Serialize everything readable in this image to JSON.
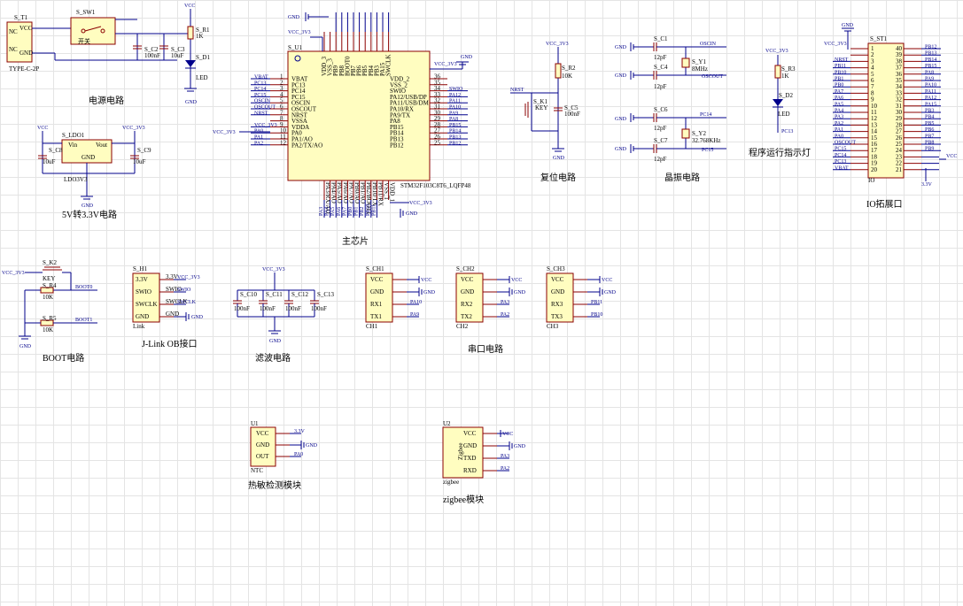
{
  "captions": {
    "power": "电源电路",
    "ldo": "5V转3.3V电路",
    "mcu": "主芯片",
    "reset": "复位电路",
    "crystal": "晶振电路",
    "led": "程序运行指示灯",
    "io": "IO拓展口",
    "boot": "BOOT电路",
    "jlink": "J-Link OB接口",
    "filter": "滤波电路",
    "serial": "串口电路",
    "thermal": "热敏检测模块",
    "zigbee": "zigbee模块"
  },
  "nets": {
    "vcc": "VCC",
    "vcc3v3": "VCC_3V3",
    "gnd": "GND",
    "v33": "3.3V"
  },
  "power": {
    "t1_ref": "S_T1",
    "t1_part": "TYPE-C-2P",
    "t1_pins": [
      "NC",
      "VCC",
      "NC",
      "GND"
    ],
    "sw1_ref": "S_SW1",
    "sw1_name": "开关",
    "c2_ref": "S_C2",
    "c2_val": "100nF",
    "c3_ref": "S_C3",
    "c3_val": "10uF",
    "r1_ref": "S_R1",
    "r1_val": "1K",
    "d1_ref": "S_D1",
    "d1_val": "LED"
  },
  "ldo": {
    "ref": "S_LDO1",
    "part": "LDO3V3",
    "pins": [
      "Vin",
      "Vout",
      "GND"
    ],
    "c8_ref": "S_C8",
    "c8_val": "10uF",
    "c9_ref": "S_C9",
    "c9_val": "10uF"
  },
  "mcu": {
    "ref": "S_U1",
    "part": "STM32F103C8T6_LQFP48",
    "left_pins": [
      "VBAT",
      "PC13",
      "PC14",
      "PC15",
      "OSCIN",
      "OSCOUT",
      "NRST",
      "VSSA",
      "VDDA",
      "PA0",
      "PA1/AO",
      "PA2/TX/AO"
    ],
    "left_nums": [
      "1",
      "2",
      "3",
      "4",
      "5",
      "6",
      "7",
      "8",
      "9",
      "10",
      "11",
      "12"
    ],
    "left_nets": [
      "VBAT",
      "PC13",
      "PC14",
      "PC15",
      "OSCIN",
      "OSCOUT",
      "NRST",
      "",
      "VCC_3V3",
      "PA0",
      "PA1",
      "PA2"
    ],
    "right_pins": [
      "VDD_2",
      "VSS_2",
      "SWIO",
      "PA12/USB/DP",
      "PA11/USB/DM",
      "PA10/RX",
      "PA9/TX",
      "PA8",
      "PB15",
      "PB14",
      "PB13",
      "PB12"
    ],
    "right_nums": [
      "36",
      "35",
      "34",
      "33",
      "32",
      "31",
      "30",
      "29",
      "28",
      "27",
      "26",
      "25"
    ],
    "right_nets": [
      "VCC_3V3",
      "",
      "SWIO",
      "PA12",
      "PA11",
      "PA10",
      "PA9",
      "PA8",
      "PB15",
      "PB14",
      "PB13",
      "PB12"
    ],
    "top_pins": [
      "VDD_3",
      "VSS_3",
      "PB9",
      "PB8",
      "BOOT0",
      "PB7",
      "PB6",
      "PB5",
      "PB4",
      "PB3",
      "PA15",
      "SWCLK"
    ],
    "bottom_pins": [
      "PA3/RX/AO",
      "PA4/AO",
      "PA5/AO",
      "PA6/AO",
      "PA7/AO",
      "PB0/AO",
      "PB1/AO",
      "PB2/BOOT1",
      "PB10/TX",
      "PB11/RX",
      "VSS_1",
      "VDD_1"
    ],
    "bottom_nets": [
      "PA3",
      "PA4",
      "PA5",
      "PA6",
      "PA7",
      "PB0",
      "PB1",
      "PB2",
      "PB10",
      "PB11",
      "",
      ""
    ]
  },
  "reset": {
    "r2_ref": "S_R2",
    "r2_val": "10K",
    "k1_ref": "S_K1",
    "k1_val": "KEY",
    "c5_ref": "S_C5",
    "c5_val": "100nF",
    "net": "NRST"
  },
  "crystal": {
    "c1_ref": "S_C1",
    "c4_ref": "S_C4",
    "c6_ref": "S_C6",
    "c7_ref": "S_C7",
    "cap_val": "12pF",
    "y1_ref": "S_Y1",
    "y1_val": "8MHz",
    "y2_ref": "S_Y2",
    "y2_val": "32.768KHz",
    "nets": [
      "OSCIN",
      "OSCOUT",
      "PC14",
      "PC15"
    ]
  },
  "led": {
    "r3_ref": "S_R3",
    "r3_val": "1K",
    "d2_ref": "S_D2",
    "d2_val": "LED",
    "net": "PC13"
  },
  "io": {
    "ref": "S_ST1",
    "part": "IO",
    "left_nums": [
      "1",
      "2",
      "3",
      "4",
      "5",
      "6",
      "7",
      "8",
      "9",
      "10",
      "11",
      "12",
      "13",
      "14",
      "15",
      "16",
      "17",
      "18",
      "19",
      "20"
    ],
    "left_nets": [
      "",
      "",
      "NRST",
      "PB11",
      "PB10",
      "PB1",
      "PB0",
      "PA7",
      "PA6",
      "PA5",
      "PA4",
      "PA3",
      "PA2",
      "PA1",
      "PA0",
      "OSCOUT",
      "PC15",
      "PC14",
      "PC13",
      "VBAT"
    ],
    "right_nums": [
      "40",
      "39",
      "38",
      "37",
      "36",
      "35",
      "34",
      "33",
      "32",
      "31",
      "30",
      "29",
      "28",
      "27",
      "26",
      "25",
      "24",
      "23",
      "22",
      "21"
    ],
    "right_nets": [
      "PB12",
      "PB13",
      "PB14",
      "PB15",
      "PA8",
      "PA9",
      "PA10",
      "PA11",
      "PA12",
      "PA15",
      "PB3",
      "PB4",
      "PB5",
      "PB6",
      "PB7",
      "PB8",
      "PB9",
      "",
      "",
      ""
    ]
  },
  "boot": {
    "k2_ref": "S_K2",
    "k2_val": "KEY",
    "r4_ref": "S_R4",
    "r4_val": "10K",
    "r5_ref": "S_R5",
    "r5_val": "10K",
    "nets": [
      "BOOT0",
      "BOOT1"
    ]
  },
  "jlink": {
    "ref": "S_H1",
    "part": "Link",
    "pins": [
      "3.3V",
      "SWIO",
      "SWCLK",
      "GND"
    ],
    "nets": [
      "VCC_3V3",
      "SWIO",
      "SWCLK",
      "GND"
    ]
  },
  "filter": {
    "caps": [
      {
        "ref": "S_C10",
        "val": "100nF"
      },
      {
        "ref": "S_C11",
        "val": "100nF"
      },
      {
        "ref": "S_C12",
        "val": "100nF"
      },
      {
        "ref": "S_C13",
        "val": "100nF"
      }
    ]
  },
  "serial": {
    "modules": [
      {
        "ref": "S_CH1",
        "part": "CH1",
        "nets": [
          "VCC",
          "GND",
          "PA10",
          "PA9"
        ]
      },
      {
        "ref": "S_CH2",
        "part": "CH2",
        "nets": [
          "VCC",
          "GND",
          "PA3",
          "PA2"
        ]
      },
      {
        "ref": "S_CH3",
        "part": "CH3",
        "nets": [
          "VCC",
          "GND",
          "PB11",
          "PB10"
        ]
      }
    ],
    "pins": [
      "VCC",
      "GND",
      "RX1",
      "TX1"
    ],
    "pins_ch2": [
      "VCC",
      "GND",
      "RX2",
      "TX2"
    ],
    "pins_ch3": [
      "VCC",
      "GND",
      "RX3",
      "TX3"
    ]
  },
  "thermal": {
    "ref": "U1",
    "part": "NTC",
    "pins": [
      "VCC",
      "GND",
      "OUT"
    ],
    "nets": [
      "3.3V",
      "GND",
      "PA0"
    ]
  },
  "zigbee": {
    "ref": "U2",
    "part": "zigbee",
    "label": "Zigbee",
    "pins": [
      "VCC",
      "GND",
      "TXD",
      "RXD"
    ],
    "nets": [
      "VCC",
      "GND",
      "PA3",
      "PA2"
    ]
  }
}
